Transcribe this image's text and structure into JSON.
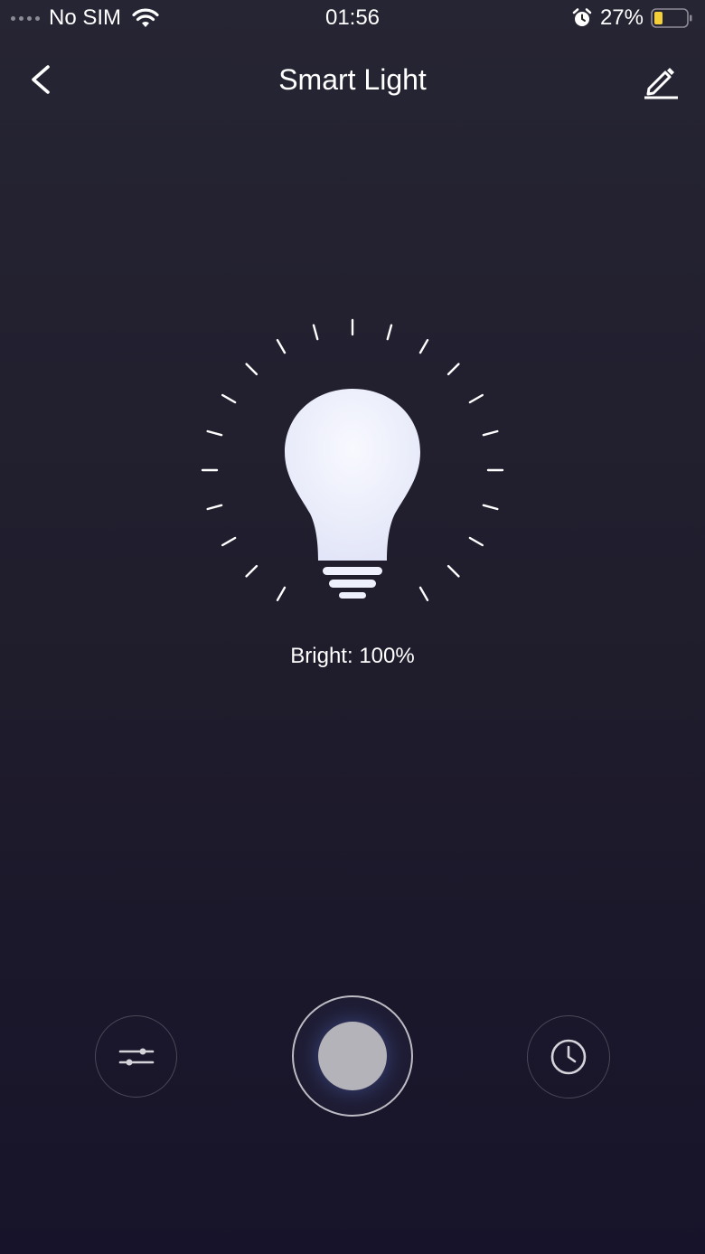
{
  "status_bar": {
    "carrier": "No SIM",
    "time": "01:56",
    "battery_percent": "27%",
    "battery_level": 0.27,
    "battery_color": "#f3cf3a"
  },
  "nav": {
    "title": "Smart Light",
    "back_icon": "chevron-left-icon",
    "edit_icon": "pencil-icon"
  },
  "light": {
    "brightness_label": "Bright: 100%",
    "brightness_value": 1.0,
    "bulb_color": "#eef0fb",
    "icon": "light-bulb-icon"
  },
  "controls": {
    "settings_icon": "sliders-icon",
    "power_icon": "power-toggle",
    "timer_icon": "clock-icon"
  },
  "colors": {
    "background_top": "#262533",
    "background_bottom": "#17132a",
    "text": "#ffffff"
  }
}
